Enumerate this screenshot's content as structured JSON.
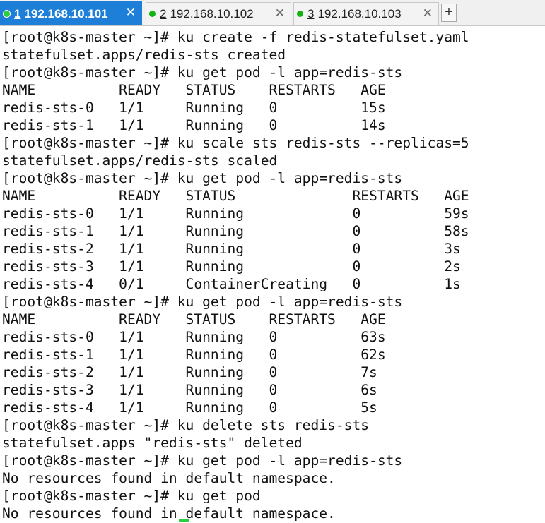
{
  "tabs": [
    {
      "number": "1",
      "host": "192.168.10.101",
      "close": "✕",
      "active": true
    },
    {
      "number": "2",
      "host": "192.168.10.102",
      "close": "✕",
      "active": false
    },
    {
      "number": "3",
      "host": "192.168.10.103",
      "close": "✕",
      "active": false
    }
  ],
  "new_tab_label": "+",
  "colors": {
    "active_tab": "#1e7fd8",
    "session_dot": "#12b312",
    "cursor": "#2ecc40"
  },
  "terminal": {
    "lines": [
      "[root@k8s-master ~]# ku create -f redis-statefulset.yaml",
      "statefulset.apps/redis-sts created",
      "[root@k8s-master ~]# ku get pod -l app=redis-sts",
      "NAME          READY   STATUS    RESTARTS   AGE",
      "redis-sts-0   1/1     Running   0          15s",
      "redis-sts-1   1/1     Running   0          14s",
      "[root@k8s-master ~]# ku scale sts redis-sts --replicas=5",
      "statefulset.apps/redis-sts scaled",
      "[root@k8s-master ~]# ku get pod -l app=redis-sts",
      "NAME          READY   STATUS              RESTARTS   AGE",
      "redis-sts-0   1/1     Running             0          59s",
      "redis-sts-1   1/1     Running             0          58s",
      "redis-sts-2   1/1     Running             0          3s",
      "redis-sts-3   1/1     Running             0          2s",
      "redis-sts-4   0/1     ContainerCreating   0          1s",
      "[root@k8s-master ~]# ku get pod -l app=redis-sts",
      "NAME          READY   STATUS    RESTARTS   AGE",
      "redis-sts-0   1/1     Running   0          63s",
      "redis-sts-1   1/1     Running   0          62s",
      "redis-sts-2   1/1     Running   0          7s",
      "redis-sts-3   1/1     Running   0          6s",
      "redis-sts-4   1/1     Running   0          5s",
      "[root@k8s-master ~]# ku delete sts redis-sts",
      "statefulset.apps \"redis-sts\" deleted",
      "[root@k8s-master ~]# ku get pod -l app=redis-sts",
      "No resources found in default namespace.",
      "[root@k8s-master ~]# ku get pod",
      "No resources found in default namespace."
    ]
  }
}
